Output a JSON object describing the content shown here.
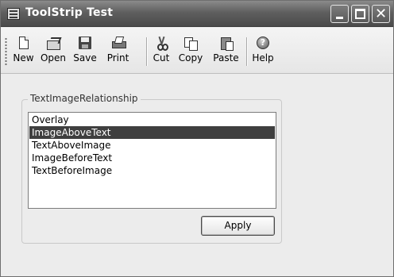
{
  "window": {
    "title": "ToolStrip Test"
  },
  "caption_buttons": {
    "minimize": "minimize-icon",
    "maximize": "maximize-icon",
    "close": "close-icon",
    "close_glyph": "✕"
  },
  "toolbar": {
    "items": [
      {
        "label": "New",
        "icon": "new-document-icon"
      },
      {
        "label": "Open",
        "icon": "open-folder-icon"
      },
      {
        "label": "Save",
        "icon": "save-disk-icon"
      },
      {
        "label": "Print",
        "icon": "printer-icon"
      },
      {
        "label": "Cut",
        "icon": "scissors-icon"
      },
      {
        "label": "Copy",
        "icon": "copy-icon"
      },
      {
        "label": "Paste",
        "icon": "paste-icon"
      },
      {
        "label": "Help",
        "icon": "help-icon"
      }
    ]
  },
  "group": {
    "label": "TextImageRelationship",
    "list": {
      "items": [
        "Overlay",
        "ImageAboveText",
        "TextAboveImage",
        "ImageBeforeText",
        "TextBeforeImage"
      ],
      "selected": "ImageAboveText"
    },
    "apply_label": "Apply"
  },
  "colors": {
    "title_bar": "#5f5f5f",
    "selection": "#3f3f3f"
  }
}
